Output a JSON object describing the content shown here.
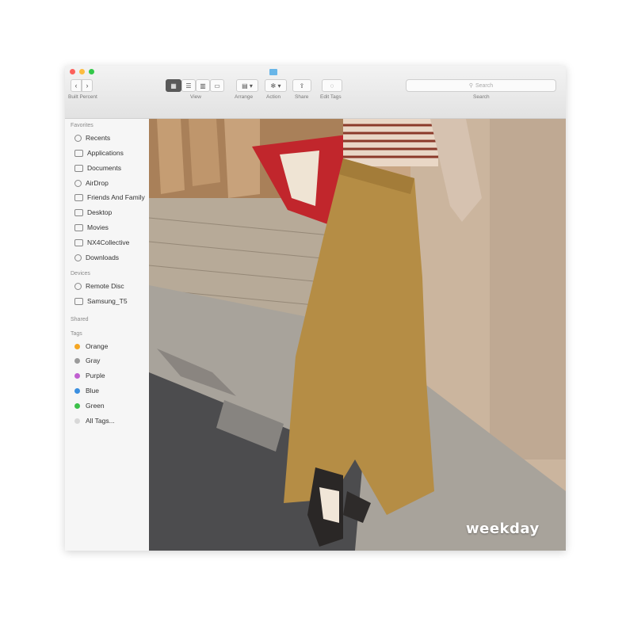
{
  "window": {
    "folder_title": "Built Percent",
    "lights": [
      "#fc605b",
      "#fdbc40",
      "#34c84a"
    ]
  },
  "toolbar": {
    "view_label": "View",
    "arrange_label": "Arrange",
    "action_label": "Action",
    "share_label": "Share",
    "edit_tags_label": "Edit Tags",
    "search_label": "Search",
    "search_placeholder": "Search"
  },
  "sidebar": {
    "favorites_header": "Favorites",
    "favorites": [
      {
        "label": "Recents",
        "icon": "clock-icon"
      },
      {
        "label": "Applications",
        "icon": "applications-icon"
      },
      {
        "label": "Documents",
        "icon": "documents-icon"
      },
      {
        "label": "AirDrop",
        "icon": "airdrop-icon"
      },
      {
        "label": "Friends And Family",
        "icon": "folder-icon"
      },
      {
        "label": "Desktop",
        "icon": "desktop-icon"
      },
      {
        "label": "Movies",
        "icon": "movies-icon"
      },
      {
        "label": "NX4Collective",
        "icon": "folder-icon"
      },
      {
        "label": "Downloads",
        "icon": "downloads-icon"
      }
    ],
    "devices_header": "Devices",
    "devices": [
      {
        "label": "Remote Disc",
        "icon": "disc-icon"
      },
      {
        "label": "Samsung_T5",
        "icon": "drive-icon"
      }
    ],
    "shared_header": "Shared",
    "tags_header": "Tags",
    "tags": [
      {
        "label": "Orange",
        "color": "#f5a623"
      },
      {
        "label": "Gray",
        "color": "#9b9b9b"
      },
      {
        "label": "Purple",
        "color": "#c060d0"
      },
      {
        "label": "Blue",
        "color": "#3b8fe0"
      },
      {
        "label": "Green",
        "color": "#3cc04a"
      },
      {
        "label": "All Tags...",
        "color": "#d8d8d8"
      }
    ]
  },
  "content": {
    "watermark": "weekday"
  }
}
